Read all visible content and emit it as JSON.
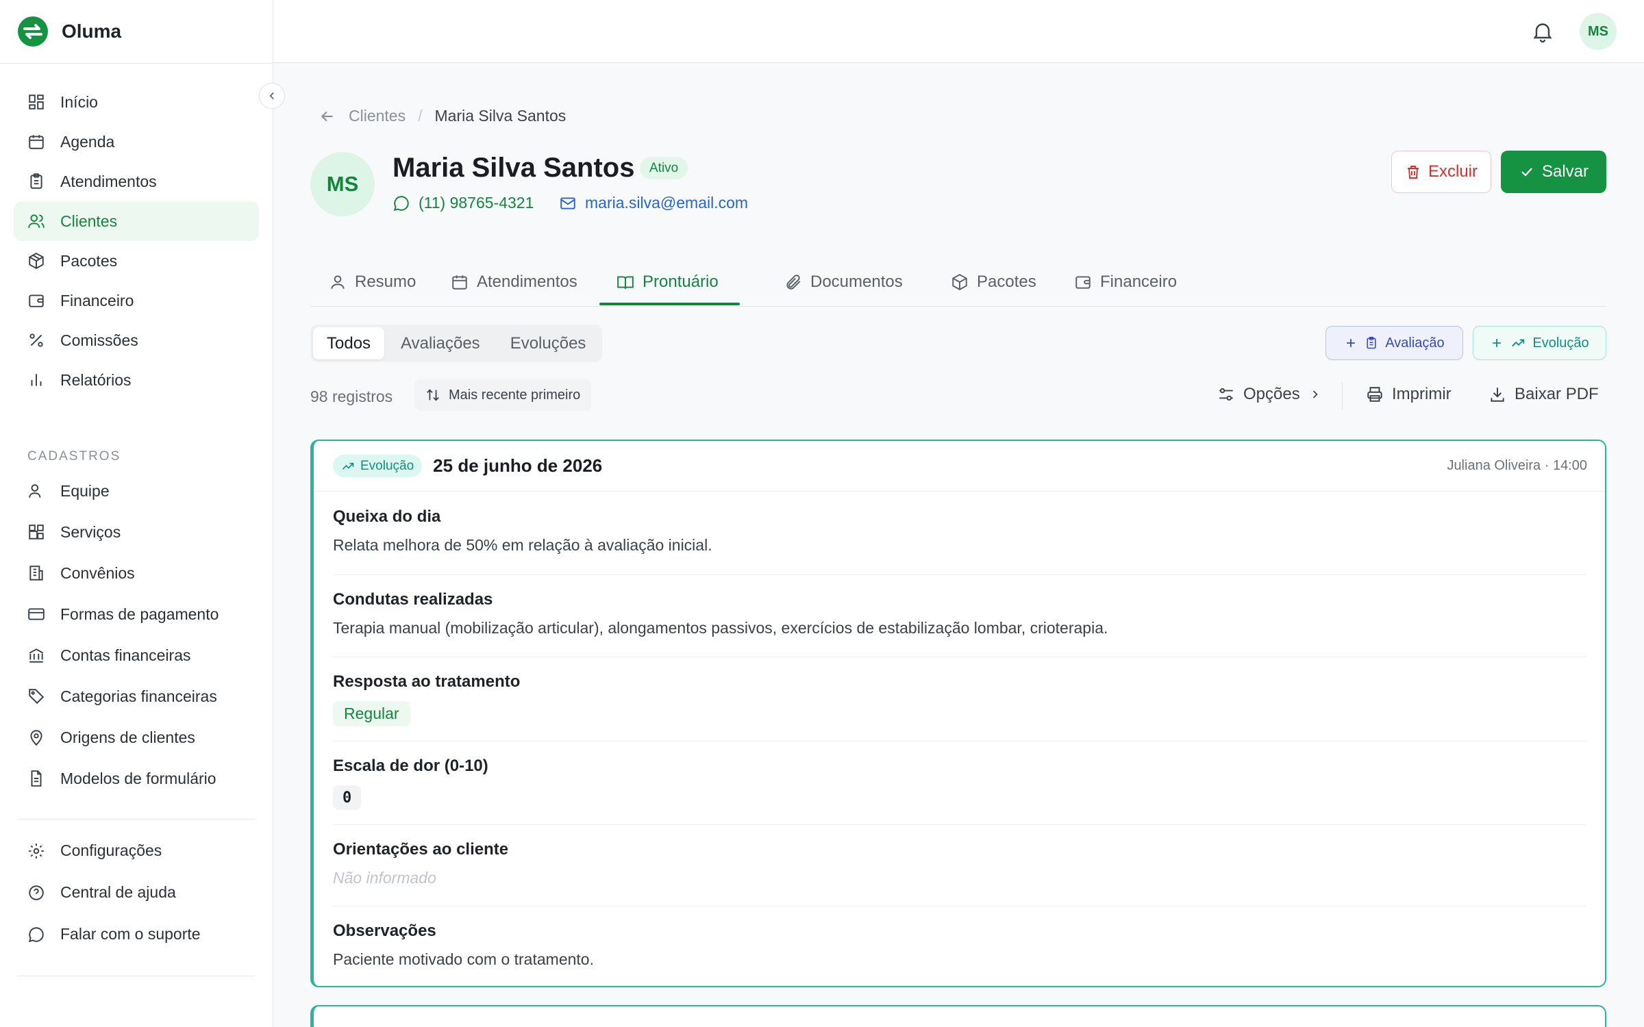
{
  "app": {
    "name": "Oluma"
  },
  "sidebar": {
    "main_items": [
      {
        "label": "Início",
        "icon": "dashboard-icon"
      },
      {
        "label": "Agenda",
        "icon": "calendar-icon"
      },
      {
        "label": "Atendimentos",
        "icon": "clipboard-icon"
      },
      {
        "label": "Clientes",
        "icon": "users-icon",
        "active": true
      },
      {
        "label": "Pacotes",
        "icon": "package-icon"
      },
      {
        "label": "Financeiro",
        "icon": "wallet-icon"
      },
      {
        "label": "Comissões",
        "icon": "percent-icon"
      },
      {
        "label": "Relatórios",
        "icon": "bar-chart-icon"
      }
    ],
    "section_label": "CADASTROS",
    "cadastro_items": [
      {
        "label": "Equipe",
        "icon": "user-icon"
      },
      {
        "label": "Serviços",
        "icon": "blocks-icon"
      },
      {
        "label": "Convênios",
        "icon": "building-icon"
      },
      {
        "label": "Formas de pagamento",
        "icon": "credit-card-icon"
      },
      {
        "label": "Contas financeiras",
        "icon": "bank-icon"
      },
      {
        "label": "Categorias financeiras",
        "icon": "tag-icon"
      },
      {
        "label": "Origens de clientes",
        "icon": "map-pin-icon"
      },
      {
        "label": "Modelos de formulário",
        "icon": "file-text-icon"
      }
    ],
    "footer_items": [
      {
        "label": "Configurações",
        "icon": "gear-icon"
      },
      {
        "label": "Central de ajuda",
        "icon": "help-circle-icon"
      },
      {
        "label": "Falar com o suporte",
        "icon": "message-circle-icon"
      }
    ]
  },
  "topbar": {
    "user_initials": "MS"
  },
  "breadcrumb": {
    "parent": "Clientes",
    "separator": "/",
    "current": "Maria Silva Santos"
  },
  "client": {
    "initials": "MS",
    "name": "Maria Silva Santos",
    "status": "Ativo",
    "phone": "(11) 98765-4321",
    "email": "maria.silva@email.com"
  },
  "actions": {
    "delete_label": "Excluir",
    "save_label": "Salvar"
  },
  "tabs": [
    {
      "label": "Resumo",
      "icon": "user-icon"
    },
    {
      "label": "Atendimentos",
      "icon": "calendar-icon"
    },
    {
      "label": "Prontuário",
      "icon": "book-open-icon",
      "active": true
    },
    {
      "label": "Documentos",
      "icon": "paperclip-icon"
    },
    {
      "label": "Pacotes",
      "icon": "package-icon"
    },
    {
      "label": "Financeiro",
      "icon": "wallet-icon"
    }
  ],
  "filter": {
    "segments": [
      {
        "label": "Todos",
        "active": true
      },
      {
        "label": "Avaliações"
      },
      {
        "label": "Evoluções"
      }
    ],
    "add_avaliacao": "Avaliação",
    "add_evolucao": "Evolução"
  },
  "toolbar": {
    "count": "98 registros",
    "sort": "Mais recente primeiro",
    "options": "Opções",
    "print": "Imprimir",
    "download": "Baixar PDF"
  },
  "record": {
    "type": "Evolução",
    "date": "25 de junho de 2026",
    "meta": "Juliana Oliveira · 14:00",
    "fields": [
      {
        "label": "Queixa do dia",
        "value": "Relata melhora de 50% em relação à avaliação inicial."
      },
      {
        "label": "Condutas realizadas",
        "value": "Terapia manual (mobilização articular), alongamentos passivos, exercícios de estabilização lombar, crioterapia."
      },
      {
        "label": "Resposta ao tratamento",
        "value": "Regular"
      },
      {
        "label": "Escala de dor (0-10)",
        "value": "0"
      },
      {
        "label": "Orientações ao cliente",
        "value": "Não informado"
      },
      {
        "label": "Observações",
        "value": "Paciente motivado com o tratamento."
      }
    ]
  },
  "colors": {
    "brand": "#14843f",
    "accent_teal": "#2bb39b",
    "danger": "#d0312d",
    "link": "#2666c6"
  }
}
